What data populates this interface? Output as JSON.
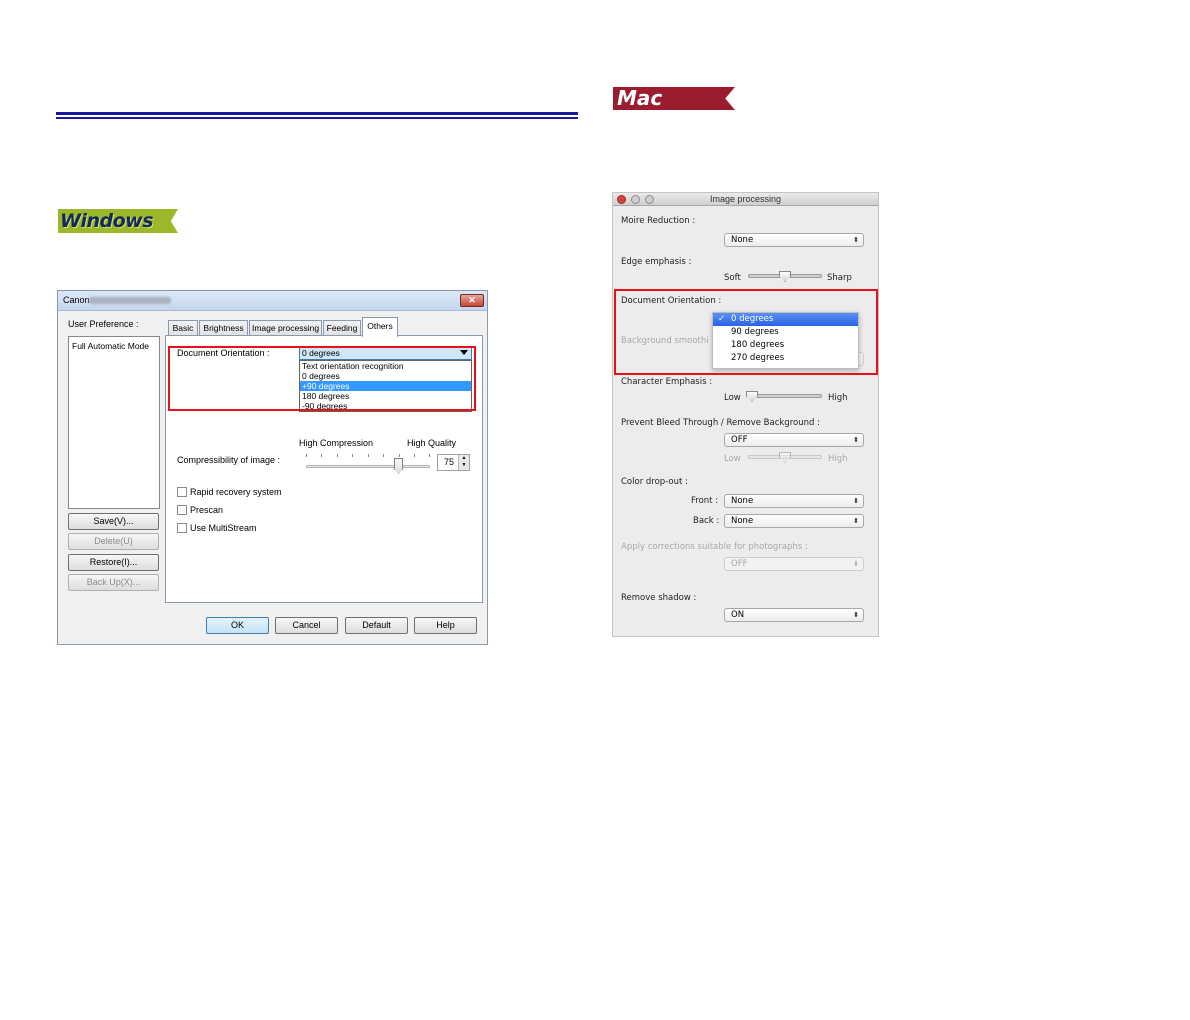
{
  "badges": {
    "windows": "Windows",
    "mac": "Mac"
  },
  "windows_dialog": {
    "title": "Canon",
    "close_label": "✕",
    "user_preference_label": "User Preference :",
    "preference_items": [
      "Full Automatic Mode"
    ],
    "side_buttons": [
      "Save(V)...",
      "Delete(U)",
      "Restore(I)...",
      "Back Up(X)..."
    ],
    "tabs": [
      "Basic",
      "Brightness",
      "Image processing",
      "Feeding",
      "Others"
    ],
    "active_tab": "Others",
    "document_orientation": {
      "label": "Document Orientation :",
      "value": "0 degrees",
      "options": [
        "Text orientation recognition",
        "0 degrees",
        "+90 degrees",
        "180 degrees",
        "-90 degrees"
      ],
      "highlighted_option": "+90 degrees"
    },
    "compressibility": {
      "label": "Compressibility of image :",
      "left_caption": "High Compression",
      "right_caption": "High Quality",
      "value": "75"
    },
    "checkboxes": [
      "Rapid recovery system",
      "Prescan",
      "Use MultiStream"
    ],
    "footer_buttons": [
      "OK",
      "Cancel",
      "Default",
      "Help"
    ]
  },
  "mac_panel": {
    "title": "Image processing",
    "moire_label": "Moire Reduction :",
    "moire_value": "None",
    "edge_label": "Edge emphasis :",
    "edge_left": "Soft",
    "edge_right": "Sharp",
    "orientation_label": "Document Orientation :",
    "orientation_options": [
      "0 degrees",
      "90 degrees",
      "180 degrees",
      "270 degrees"
    ],
    "orientation_selected": "0 degrees",
    "check_mark": "✓",
    "background_smoothing_label": "Background smoothi",
    "character_emphasis_label": "Character Emphasis :",
    "char_left": "Low",
    "char_right": "High",
    "bleed_label": "Prevent Bleed Through / Remove Background :",
    "bleed_value": "OFF",
    "bleed_left": "Low",
    "bleed_right": "High",
    "dropout_label": "Color drop-out :",
    "front_label": "Front :",
    "front_value": "None",
    "back_label": "Back :",
    "back_value": "None",
    "photo_label": "Apply corrections suitable for photographs :",
    "photo_value": "OFF",
    "shadow_label": "Remove shadow :",
    "shadow_value": "ON",
    "select_arrow": "⬍"
  }
}
